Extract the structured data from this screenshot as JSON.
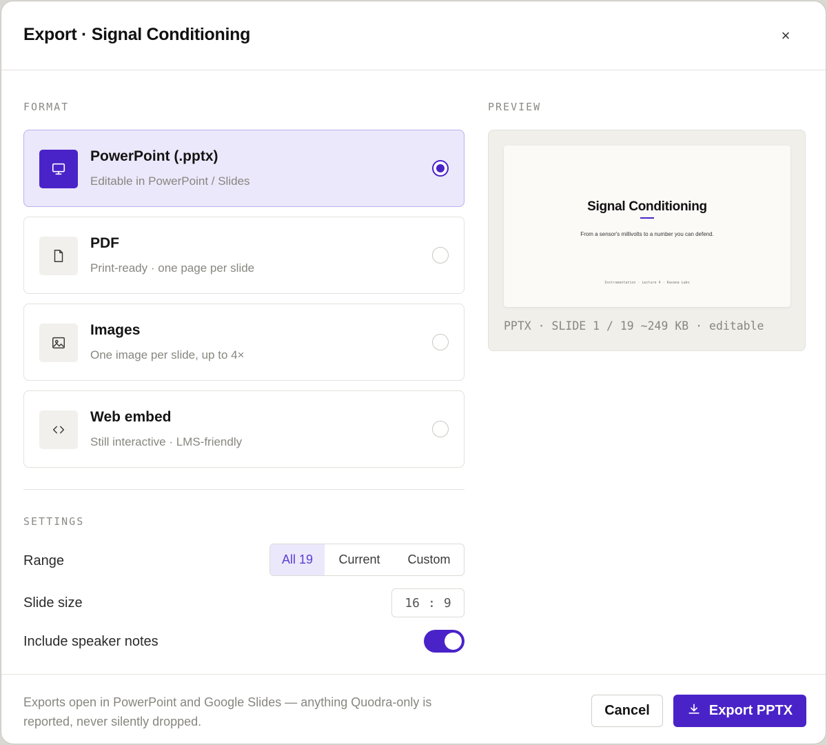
{
  "dialog": {
    "title": "Export · Signal Conditioning",
    "close_icon": "×"
  },
  "format": {
    "section_label": "FORMAT",
    "options": [
      {
        "name": "PowerPoint (.pptx)",
        "desc": "Editable in PowerPoint / Slides",
        "icon": "monitor-icon",
        "selected": true
      },
      {
        "name": "PDF",
        "desc": "Print-ready · one page per slide",
        "icon": "document-icon",
        "selected": false
      },
      {
        "name": "Images",
        "desc": "One image per slide, up to 4×",
        "icon": "image-icon",
        "selected": false
      },
      {
        "name": "Web embed",
        "desc": "Still interactive · LMS-friendly",
        "icon": "code-icon",
        "selected": false
      }
    ]
  },
  "settings": {
    "section_label": "SETTINGS",
    "range": {
      "label": "Range",
      "options": [
        "All 19",
        "Current",
        "Custom"
      ],
      "selected": "All 19"
    },
    "slide_size": {
      "label": "Slide size",
      "w": "16",
      "sep": ":",
      "h": "9"
    },
    "speaker_notes": {
      "label": "Include speaker notes",
      "on": true
    }
  },
  "preview": {
    "section_label": "PREVIEW",
    "slide": {
      "title": "Signal Conditioning",
      "subtitle": "From a sensor's millivolts to a number you can defend.",
      "footer": "Instrumentation · Lecture 4 · Kavana Labs"
    },
    "meta": "PPTX · SLIDE 1 / 19 ~249 KB · editable"
  },
  "footer": {
    "note": "Exports open in PowerPoint and Google Slides — anything Quodra-only is reported, never silently dropped.",
    "cancel_label": "Cancel",
    "export_label": "Export PPTX"
  },
  "colors": {
    "accent": "#4a23c8",
    "accent_soft": "#ece8fb",
    "muted_text": "#87867f"
  }
}
